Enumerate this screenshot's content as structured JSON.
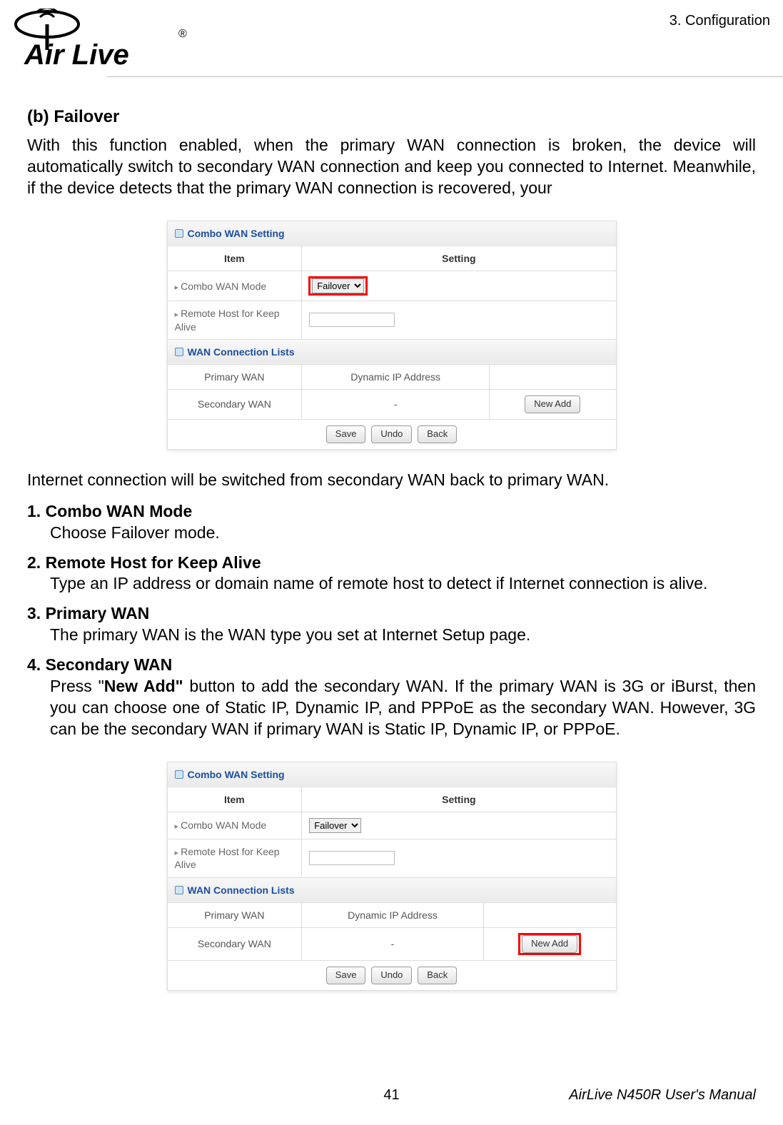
{
  "header": {
    "brand": "Air Live",
    "registered": "®",
    "chapter": "3. Configuration"
  },
  "section": {
    "label": "(b)  Failover",
    "intro": "With this function enabled, when the primary WAN connection is broken, the device will automatically switch to secondary WAN connection and keep you connected to Internet. Meanwhile, if the device detects that the primary WAN connection is recovered, your"
  },
  "fig1": {
    "hdr1": "Combo WAN Setting",
    "item": "Item",
    "setting": "Setting",
    "row1_label": "Combo WAN Mode",
    "row1_value": "Failover",
    "row2_label": "Remote Host for Keep Alive",
    "hdr2": "WAN Connection Lists",
    "primary_label": "Primary WAN",
    "primary_value": "Dynamic IP Address",
    "secondary_label": "Secondary WAN",
    "secondary_value": "-",
    "new_add": "New Add",
    "save": "Save",
    "undo": "Undo",
    "back": "Back"
  },
  "post_fig": "Internet connection will be switched from secondary WAN back to primary WAN.",
  "list": [
    {
      "num": "1.",
      "title": "Combo WAN Mode",
      "body": "Choose Failover mode."
    },
    {
      "num": "2.",
      "title": "Remote Host for Keep Alive",
      "body": "Type an IP address or domain name of remote host to detect if Internet connection is alive."
    },
    {
      "num": "3.",
      "title": "Primary WAN",
      "body": "The primary WAN is the WAN type you set at Internet Setup page."
    },
    {
      "num": "4.",
      "title": "Secondary WAN",
      "body_pre": "Press \"",
      "body_bold": "New Add\"",
      "body_post": " button to add the secondary WAN. If the primary WAN is 3G or iBurst, then you can choose one of Static IP, Dynamic IP, and PPPoE as the secondary WAN. However, 3G can be the secondary WAN if primary WAN is Static IP, Dynamic IP, or PPPoE."
    }
  ],
  "fig2": {
    "hdr1": "Combo WAN Setting",
    "item": "Item",
    "setting": "Setting",
    "row1_label": "Combo WAN Mode",
    "row1_value": "Failover",
    "row2_label": "Remote Host for Keep Alive",
    "hdr2": "WAN Connection Lists",
    "primary_label": "Primary WAN",
    "primary_value": "Dynamic IP Address",
    "secondary_label": "Secondary WAN",
    "secondary_value": "-",
    "new_add": "New Add",
    "save": "Save",
    "undo": "Undo",
    "back": "Back"
  },
  "footer": {
    "page": "41",
    "manual": "AirLive N450R User's Manual"
  }
}
